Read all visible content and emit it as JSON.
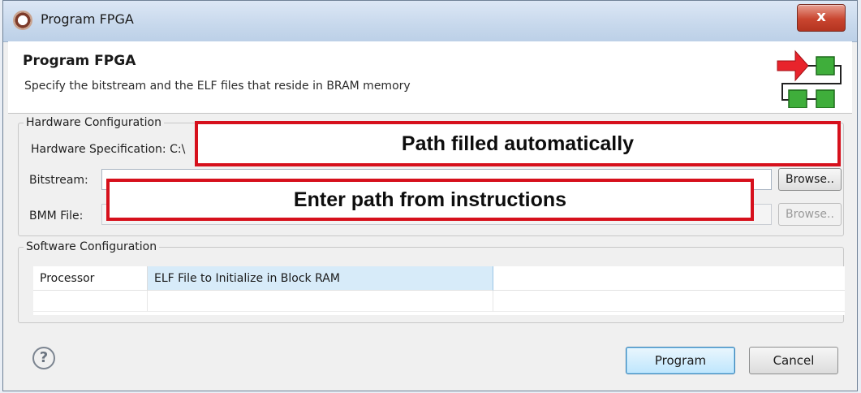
{
  "window": {
    "title": "Program FPGA",
    "close_label": "x"
  },
  "header": {
    "title": "Program FPGA",
    "description": "Specify the bitstream and the ELF files that reside in BRAM memory"
  },
  "hardware": {
    "legend": "Hardware Configuration",
    "spec_label": "Hardware Specification: C:\\",
    "bitstream_label": "Bitstream:",
    "bitstream_value": "",
    "bitstream_browse": "Browse..",
    "bmm_label": "BMM File:",
    "bmm_value": "",
    "bmm_browse": "Browse.."
  },
  "annotations": {
    "auto": "Path filled automatically",
    "enter": "Enter path from instructions",
    "border_color": "#d6101c"
  },
  "software": {
    "legend": "Software Configuration",
    "columns": [
      "Processor",
      "ELF File to Initialize in Block RAM",
      ""
    ],
    "rows": [
      [
        "",
        "",
        ""
      ]
    ]
  },
  "footer": {
    "help_glyph": "?",
    "program_label": "Program",
    "cancel_label": "Cancel"
  },
  "icons": {
    "app": "sdk-icon",
    "help": "help-icon",
    "wizard": "flow-diagram-icon"
  }
}
